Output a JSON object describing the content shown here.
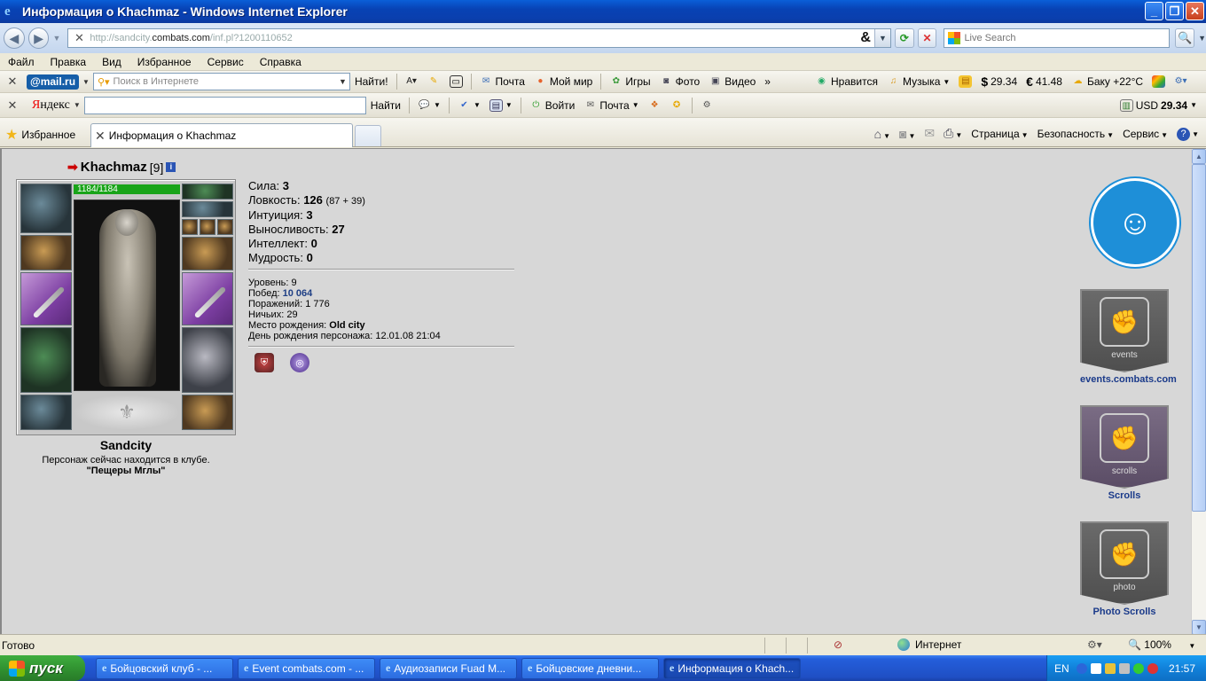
{
  "window": {
    "title": "Информация о Khachmaz - Windows Internet Explorer"
  },
  "address": {
    "url_prefix": "http://sandcity.",
    "url_domain": "combats.com",
    "url_path": "/inf.pl?1200110652",
    "amp": "&"
  },
  "search": {
    "placeholder": "Live Search"
  },
  "menu": [
    "Файл",
    "Правка",
    "Вид",
    "Избранное",
    "Сервис",
    "Справка"
  ],
  "mailru_toolbar": {
    "logo": "@mail.ru",
    "search_placeholder": "Поиск в Интернете",
    "find_label": "Найти!",
    "items": [
      "Почта",
      "Мой мир",
      "Игры",
      "Фото",
      "Видео"
    ],
    "more": "»",
    "likes": "Нравится",
    "music": "Музыка",
    "usd": "29.34",
    "eur": "41.48",
    "weather": "Баку +22°C"
  },
  "yandex_toolbar": {
    "logo_red": "Я",
    "logo_rest": "ндекс",
    "find_label": "Найти",
    "login_label": "Войти",
    "mail_label": "Почта",
    "currency_label": "USD",
    "currency_value": "29.34"
  },
  "tabs": {
    "favorites_label": "Избранное",
    "active_tab": "Информация о Khachmaz",
    "commands": [
      "Страница",
      "Безопасность",
      "Сервис"
    ]
  },
  "character": {
    "name": "Khachmaz",
    "level": "[9]",
    "hp": "1184/1184",
    "club": "Sandcity",
    "location_line1": "Персонаж сейчас находится в клубе.",
    "location_line2": "\"Пещеры Мглы\"",
    "stats": [
      {
        "label": "Сила:",
        "value": "3",
        "extra": ""
      },
      {
        "label": "Ловкость:",
        "value": "126",
        "extra": "(87 + 39)"
      },
      {
        "label": "Интуиция:",
        "value": "3",
        "extra": ""
      },
      {
        "label": "Выносливость:",
        "value": "27",
        "extra": ""
      },
      {
        "label": "Интеллект:",
        "value": "0",
        "extra": ""
      },
      {
        "label": "Мудрость:",
        "value": "0",
        "extra": ""
      }
    ],
    "info": {
      "level_label": "Уровень:",
      "level_value": "9",
      "wins_label": "Побед:",
      "wins_value": "10 064",
      "losses_label": "Поражений:",
      "losses_value": "1 776",
      "draws_label": "Ничьих:",
      "draws_value": "29",
      "birthplace_label": "Место рождения:",
      "birthplace_value": "Old city",
      "birthday_label": "День рождения персонажа:",
      "birthday_value": "12.01.08 21:04"
    }
  },
  "sidebar": {
    "banners": [
      {
        "flag_text": "events",
        "caption": "events.combats.com"
      },
      {
        "flag_text": "scrolls",
        "caption": "Scrolls"
      },
      {
        "flag_text": "photo",
        "caption": "Photo Scrolls"
      }
    ]
  },
  "status": {
    "text": "Готово",
    "zone": "Интернет",
    "zoom": "100%"
  },
  "taskbar": {
    "start_label": "пуск",
    "buttons": [
      "Бойцовский клуб - ...",
      "Event combats.com - ...",
      "Аудиозаписи Fuad M...",
      "Бойцовские дневни...",
      "Информация о Khach..."
    ],
    "lang": "EN",
    "clock": "21:57"
  }
}
